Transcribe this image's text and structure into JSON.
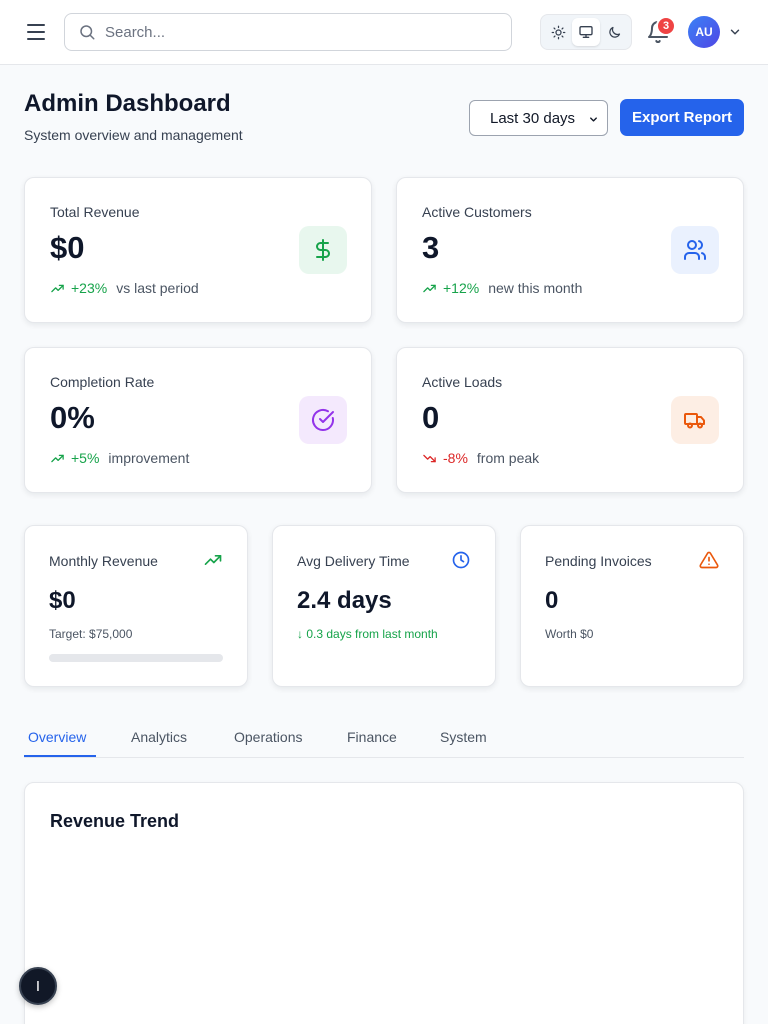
{
  "header": {
    "menu_icon": "menu-icon",
    "search": {
      "placeholder": "Search...",
      "value": ""
    },
    "theme_modes": [
      "light",
      "system",
      "dark"
    ],
    "theme_active": "system",
    "notifications_count": "3",
    "avatar_initials": "AU"
  },
  "page": {
    "title": "Admin Dashboard",
    "subtitle": "System overview and management",
    "period_select": "Last 30 days",
    "export_label": "Export Report"
  },
  "stats": [
    {
      "label": "Total Revenue",
      "value": "$0",
      "pct": "+23%",
      "note": "vs last period",
      "direction": "up",
      "icon": "dollar-icon",
      "color": "#16a34a",
      "bg": "#e8f7ee"
    },
    {
      "label": "Active Customers",
      "value": "3",
      "pct": "+12%",
      "note": "new this month",
      "direction": "up",
      "icon": "users-icon",
      "color": "#2563eb",
      "bg": "#eaf1fe"
    },
    {
      "label": "Completion Rate",
      "value": "0%",
      "pct": "+5%",
      "note": "improvement",
      "direction": "up",
      "icon": "check-circle-icon",
      "color": "#9333ea",
      "bg": "#f4e9fd"
    },
    {
      "label": "Active Loads",
      "value": "0",
      "pct": "-8%",
      "note": "from peak",
      "direction": "down",
      "icon": "truck-icon",
      "color": "#ea580c",
      "bg": "#fdeee4"
    }
  ],
  "metrics": [
    {
      "label": "Monthly Revenue",
      "value": "$0",
      "sub": "Target: $75,000",
      "icon": "trending-up-icon",
      "progress": 0
    },
    {
      "label": "Avg Delivery Time",
      "value": "2.4 days",
      "sub": "0.3 days from last month",
      "sub_arrow": "↓",
      "icon": "clock-icon"
    },
    {
      "label": "Pending Invoices",
      "value": "0",
      "sub": "Worth $0",
      "icon": "warning-icon"
    }
  ],
  "tabs": [
    "Overview",
    "Analytics",
    "Operations",
    "Finance",
    "System"
  ],
  "active_tab": "Overview",
  "chart": {
    "title": "Revenue Trend"
  },
  "fab_label": "I"
}
